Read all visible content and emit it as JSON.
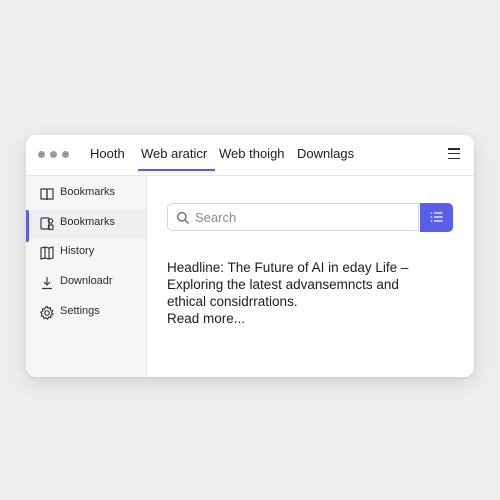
{
  "window": {
    "tabs": [
      {
        "label": "Hooth"
      },
      {
        "label": "Web araticr"
      },
      {
        "label": "Web thoigh"
      },
      {
        "label": "Downlags"
      }
    ],
    "active_tab": 1
  },
  "sidebar": {
    "items": [
      {
        "label": "Bookmarks",
        "icon": "book-icon"
      },
      {
        "label": "Bookmarks",
        "icon": "bookmarks-icon"
      },
      {
        "label": "History",
        "icon": "history-book-icon"
      },
      {
        "label": "Downloadr",
        "icon": "download-icon"
      },
      {
        "label": "Settings",
        "icon": "gear-icon"
      }
    ],
    "selected_index": 1
  },
  "search": {
    "placeholder": "Search"
  },
  "article": {
    "lines": [
      "Headline: The Future of AI in eday Life –",
      "Exploring the latest advansemncts and",
      "ethical considrrations."
    ],
    "read_more": "Read more..."
  },
  "colors": {
    "accent": "#5a5ee6",
    "background": "#ededee"
  }
}
